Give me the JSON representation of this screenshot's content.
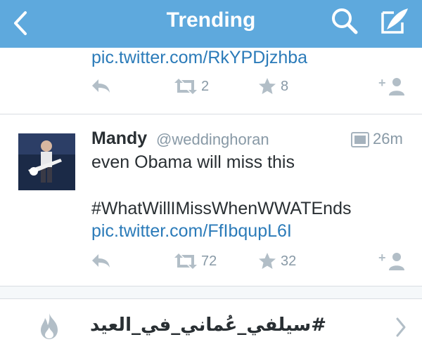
{
  "header": {
    "title": "Trending"
  },
  "tweets": [
    {
      "link": "pic.twitter.com/RkYPDjzhba",
      "retweets": "2",
      "favorites": "8"
    },
    {
      "name": "Mandy",
      "handle": "@weddinghoran",
      "time": "26m",
      "lines": [
        "even Obama will miss this",
        "#WhatWillIMissWhenWWATEnds"
      ],
      "link": "pic.twitter.com/FfIbqupL6I",
      "retweets": "72",
      "favorites": "32"
    }
  ],
  "trend": {
    "label": "#سيلفي_عُماني_في_العيد"
  },
  "colors": {
    "nav": "#5ea9dd",
    "link": "#2b7bb9",
    "muted": "#8899a6"
  },
  "icons": [
    "back-chevron-icon",
    "search-icon",
    "compose-icon",
    "reply-icon",
    "retweet-icon",
    "star-icon",
    "follow-icon",
    "media-icon",
    "flame-icon",
    "chevron-right-icon"
  ]
}
